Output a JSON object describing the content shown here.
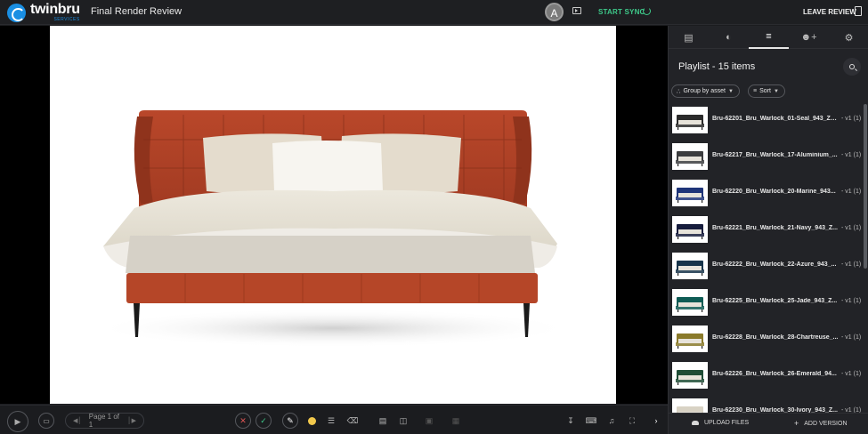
{
  "app": {
    "logo_name": "twinbru",
    "logo_sub": "SERVICES",
    "title": "Final Render Review",
    "avatar_letter": "A",
    "start_sync": "START SYNC",
    "leave_review": "LEAVE REVIEW"
  },
  "toolbar": {
    "page_label": "Page 1 of 1",
    "annotation_color": "#f2c94c"
  },
  "sidebar": {
    "tabs": [
      {
        "name": "comments",
        "icon": "comment-icon"
      },
      {
        "name": "palette",
        "icon": "palette-icon"
      },
      {
        "name": "playlist",
        "icon": "playlist-icon"
      },
      {
        "name": "add-user",
        "icon": "add-user-icon"
      },
      {
        "name": "settings",
        "icon": "gear-icon"
      }
    ],
    "playlist_title": "Playlist - 15 items",
    "group_by": "Group by asset",
    "sort": "Sort",
    "items": [
      {
        "name": "Bru-62201_Bru_Warlock_01-Seal_943_Ze...",
        "version": "- v1 (1)",
        "color": "#2a2a2a"
      },
      {
        "name": "Bru-62217_Bru_Warlock_17-Aluminium_...",
        "version": "- v1 (1)",
        "color": "#3b3c3e"
      },
      {
        "name": "Bru-62220_Bru_Warlock_20-Marine_943...",
        "version": "- v1 (1)",
        "color": "#1f3579"
      },
      {
        "name": "Bru-62221_Bru_Warlock_21-Navy_943_Z...",
        "version": "- v1 (1)",
        "color": "#161c3c"
      },
      {
        "name": "Bru-62222_Bru_Warlock_22-Azure_943_...",
        "version": "- v1 (1)",
        "color": "#17344a"
      },
      {
        "name": "Bru-62225_Bru_Warlock_25-Jade_943_Z...",
        "version": "- v1 (1)",
        "color": "#0f5c55"
      },
      {
        "name": "Bru-62228_Bru_Warlock_28-Chartreuse_...",
        "version": "- v1 (1)",
        "color": "#8a7a2a"
      },
      {
        "name": "Bru-62226_Bru_Warlock_26-Emerald_94...",
        "version": "- v1 (1)",
        "color": "#1f4d36"
      },
      {
        "name": "Bru-62230_Bru_Warlock_30-Ivory_943_Z...",
        "version": "- v1 (1)",
        "color": "#d8d2c4"
      }
    ],
    "upload_files": "UPLOAD FILES",
    "add_version": "ADD VERSION"
  }
}
